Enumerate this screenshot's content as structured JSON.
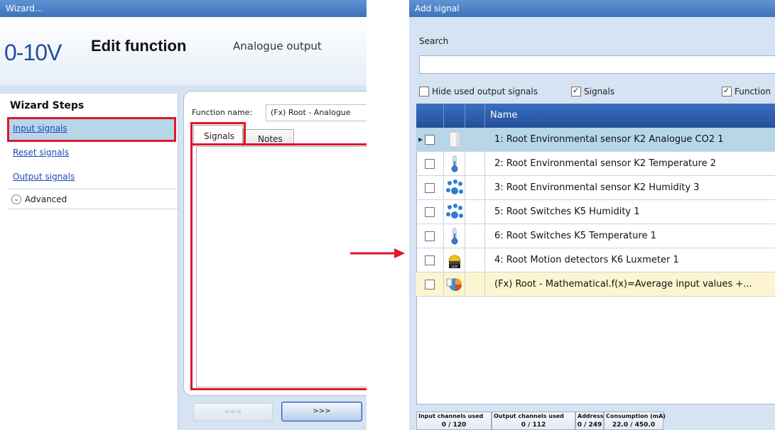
{
  "wizard": {
    "title": "Wizard...",
    "logo_text": "0-10V",
    "edit_title": "Edit function",
    "edit_subtitle": "Analogue output",
    "steps_title": "Wizard Steps",
    "steps": [
      "Input signals",
      "Reset signals",
      "Output signals"
    ],
    "advanced_label": "Advanced",
    "function_name_label": "Function name:",
    "function_name_value": "(Fx) Root - Analogue",
    "tabs": [
      "Signals",
      "Notes"
    ],
    "back_button": "<<<",
    "next_button": ">>>"
  },
  "add_signal": {
    "title": "Add signal",
    "search_label": "Search",
    "search_value": "",
    "filters": [
      {
        "label": "Hide used output signals",
        "checked": false
      },
      {
        "label": "Signals",
        "checked": true
      },
      {
        "label": "Function",
        "checked": true
      }
    ],
    "grid_header": "Name",
    "rows": [
      {
        "name": "1: Root Environmental sensor K2 Analogue CO2 1",
        "icon": "analogue-sensor-icon",
        "selected": true
      },
      {
        "name": "2: Root Environmental sensor K2 Temperature 2",
        "icon": "thermometer-icon"
      },
      {
        "name": "3: Root Environmental sensor K2 Humidity 3",
        "icon": "humidity-drops-icon"
      },
      {
        "name": "5: Root Switches K5 Humidity 1",
        "icon": "humidity-drops-icon"
      },
      {
        "name": "6: Root Switches K5 Temperature 1",
        "icon": "thermometer-icon"
      },
      {
        "name": "4: Root Motion detectors K6 Luxmeter 1",
        "icon": "luxmeter-icon"
      },
      {
        "name": "(Fx) Root - Mathematical.f(x)=Average input values +...",
        "icon": "math-function-icon",
        "highlight": true
      }
    ],
    "status": [
      {
        "label": "Input channels used",
        "value": "0 / 120"
      },
      {
        "label": "Output channels used",
        "value": "0 / 112"
      },
      {
        "label": "Address",
        "value": "0 / 249"
      },
      {
        "label": "Consumption (mA)",
        "value": "22.0 / 450.0"
      }
    ]
  },
  "colors": {
    "titlebar": "#4a7fc6",
    "highlight_red": "#e0172b",
    "grid_header": "#2f5fae",
    "selected_row": "#b7d6e8",
    "function_row": "#fdf5cf"
  }
}
